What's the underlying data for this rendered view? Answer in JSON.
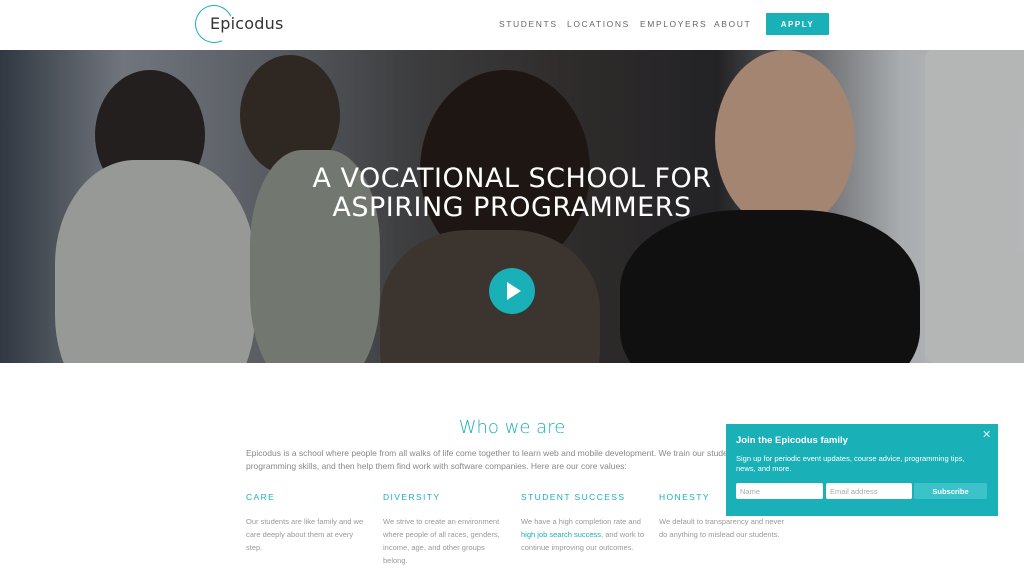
{
  "header": {
    "logo_text": "Epicodus",
    "nav": [
      {
        "label": "STUDENTS"
      },
      {
        "label": "LOCATIONS"
      },
      {
        "label": "EMPLOYERS"
      },
      {
        "label": "ABOUT"
      }
    ],
    "apply_label": "APPLY"
  },
  "hero": {
    "title_line1": "A VOCATIONAL SCHOOL FOR",
    "title_line2": "ASPIRING PROGRAMMERS",
    "play_icon": "play-icon"
  },
  "who": {
    "title": "Who we are",
    "intro": "Epicodus is a school where people from all walks of life come together to learn web and mobile development. We train our students in high-demand programming skills, and then help them find work with software companies. Here are our core values:",
    "values": [
      {
        "heading": "CARE",
        "body": "Our students are like family and we care deeply about them at every step."
      },
      {
        "heading": "DIVERSITY",
        "body": "We strive to create an environment where people of all races, genders, income, age, and other groups belong."
      },
      {
        "heading": "STUDENT SUCCESS",
        "body_before": "We have a high completion rate and ",
        "body_link": "high job search success",
        "body_after": ", and work to continue improving our outcomes."
      },
      {
        "heading": "HONESTY",
        "body": "We default to transparency and never do anything to mislead our students."
      }
    ]
  },
  "popup": {
    "title": "Join the Epicodus family",
    "text": "Sign up for periodic event updates, course advice, programming tips, news, and more.",
    "name_placeholder": "Name",
    "email_placeholder": "Email address",
    "subscribe_label": "Subscribe",
    "close_glyph": "✕"
  },
  "colors": {
    "accent": "#1ab0b8"
  }
}
